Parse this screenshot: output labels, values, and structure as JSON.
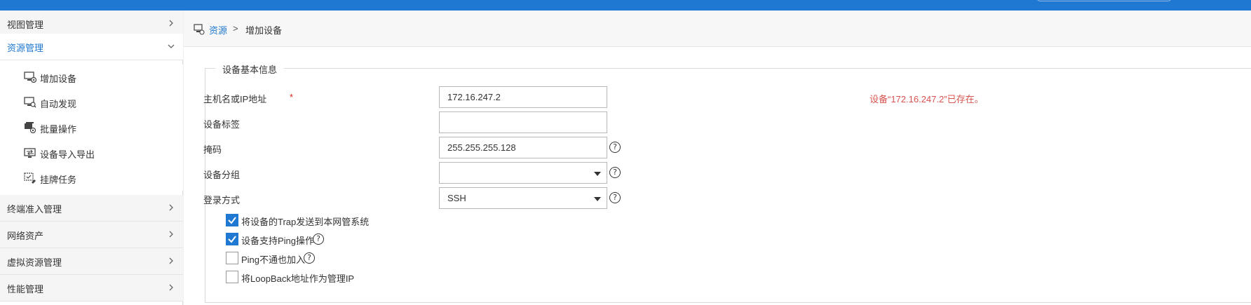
{
  "sidebar": {
    "menu": [
      {
        "label": "视图管理"
      },
      {
        "label": "资源管理"
      },
      {
        "label": "终端准入管理"
      },
      {
        "label": "网络资产"
      },
      {
        "label": "虚拟资源管理"
      },
      {
        "label": "性能管理"
      }
    ],
    "sub_items": [
      {
        "label": "增加设备",
        "icon": "add-device-icon"
      },
      {
        "label": "自动发现",
        "icon": "auto-discover-icon"
      },
      {
        "label": "批量操作",
        "icon": "batch-operation-icon"
      },
      {
        "label": "设备导入导出",
        "icon": "import-export-icon"
      },
      {
        "label": "挂牌任务",
        "icon": "tag-task-icon"
      }
    ]
  },
  "breadcrumb": {
    "link": "资源",
    "separator": ">",
    "current": "增加设备"
  },
  "form": {
    "legend": "设备基本信息",
    "host": {
      "label": "主机名或IP地址",
      "required_mark": "*",
      "value": "172.16.247.2"
    },
    "tag": {
      "label": "设备标签",
      "value": ""
    },
    "mask": {
      "label": "掩码",
      "value": "255.255.255.128"
    },
    "group": {
      "label": "设备分组",
      "value": ""
    },
    "login": {
      "label": "登录方式",
      "value": "SSH"
    },
    "help_glyph": "?",
    "error_message": "设备“172.16.247.2”已存在。",
    "checkboxes": [
      {
        "label": "将设备的Trap发送到本网管系统",
        "checked": true
      },
      {
        "label": "设备支持Ping操作",
        "checked": true
      },
      {
        "label": "Ping不通也加入",
        "checked": false
      },
      {
        "label": "将LoopBack地址作为管理IP",
        "checked": false
      }
    ]
  },
  "colors": {
    "accent": "#1f78d1",
    "error": "#d9534f",
    "required": "#e1251b"
  }
}
